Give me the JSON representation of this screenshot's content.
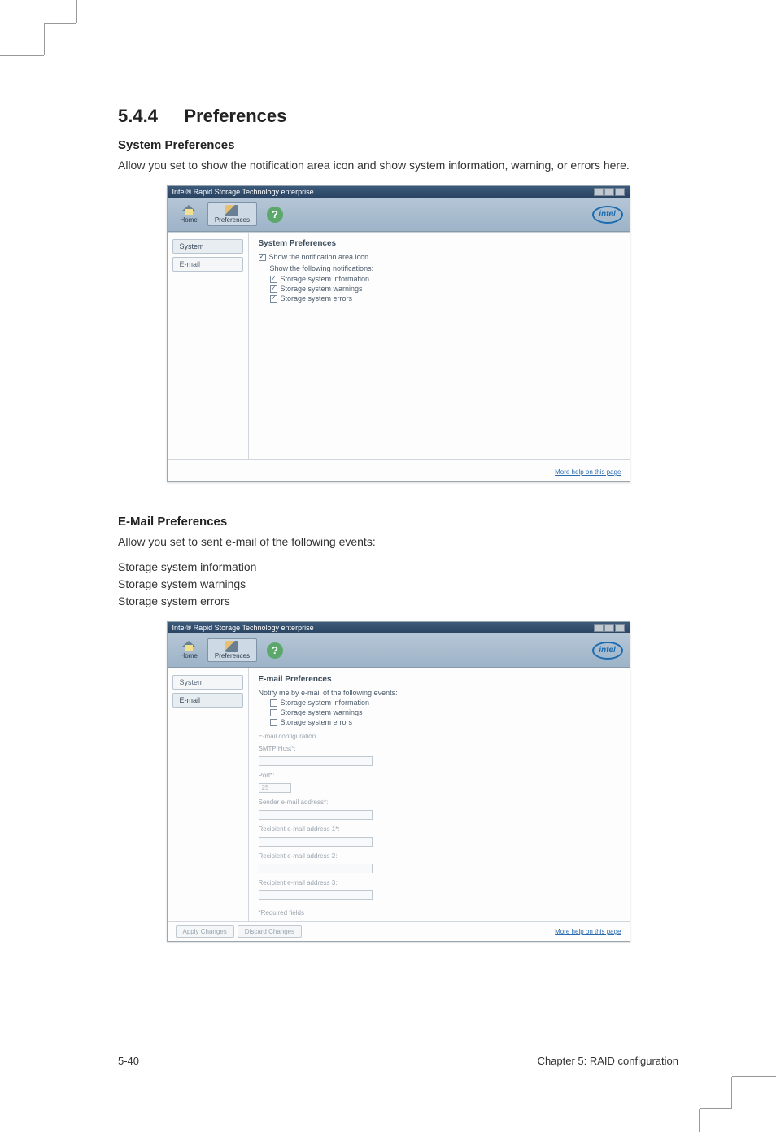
{
  "section": {
    "num": "5.4.4",
    "title": "Preferences"
  },
  "sys": {
    "heading": "System Preferences",
    "body": "Allow you set to show the notification area icon and show system information, warning, or errors here."
  },
  "email": {
    "heading": "E-Mail Preferences",
    "body": "Allow you set to sent e-mail of the following events:",
    "events": [
      "Storage system information",
      "Storage system warnings",
      "Storage system errors"
    ]
  },
  "app": {
    "title": "Intel® Rapid Storage Technology enterprise",
    "toolbar": {
      "home": "Home",
      "prefs": "Preferences"
    },
    "logo": "intel",
    "side": {
      "system": "System",
      "email": "E-mail"
    },
    "help": "?",
    "more_help": "More help on this page"
  },
  "pane_sys": {
    "title": "System Preferences",
    "show_icon": "Show the notification area icon",
    "show_following": "Show the following notifications:",
    "n1": "Storage system information",
    "n2": "Storage system warnings",
    "n3": "Storage system errors"
  },
  "pane_email": {
    "title": "E-mail Preferences",
    "notify": "Notify me by e-mail of the following events:",
    "n1": "Storage system information",
    "n2": "Storage system warnings",
    "n3": "Storage system errors",
    "cfg": "E-mail configuration",
    "smtp": "SMTP Host*:",
    "port": "Port*:",
    "port_val": "25",
    "sender": "Sender e-mail address*:",
    "r1": "Recipient e-mail address 1*:",
    "r2": "Recipient e-mail address 2:",
    "r3": "Recipient e-mail address 3:",
    "req": "*Required fields",
    "apply": "Apply Changes",
    "discard": "Discard Changes"
  },
  "footer": {
    "left": "5-40",
    "right": "Chapter 5: RAID configuration"
  }
}
